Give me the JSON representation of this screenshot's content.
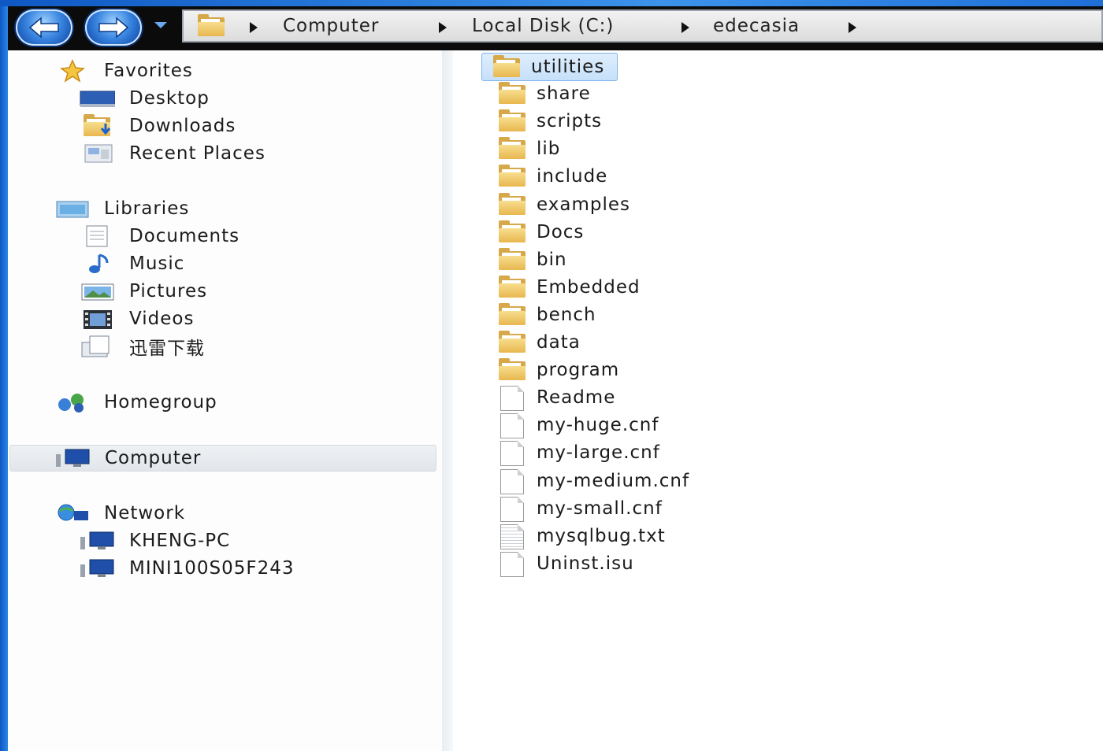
{
  "address_bar": {
    "crumbs": [
      "Computer",
      "Local Disk (C:)",
      "edecasia"
    ]
  },
  "nav_pane": {
    "favorites": {
      "label": "Favorites",
      "items": [
        "Desktop",
        "Downloads",
        "Recent Places"
      ]
    },
    "libraries": {
      "label": "Libraries",
      "items": [
        "Documents",
        "Music",
        "Pictures",
        "Videos",
        "迅雷下载"
      ]
    },
    "homegroup": {
      "label": "Homegroup"
    },
    "computer": {
      "label": "Computer"
    },
    "network": {
      "label": "Network",
      "items": [
        "KHENG-PC",
        "MINI100S05F243"
      ]
    }
  },
  "content": {
    "items": [
      {
        "name": "utilities",
        "type": "folder",
        "selected": true
      },
      {
        "name": "share",
        "type": "folder"
      },
      {
        "name": "scripts",
        "type": "folder"
      },
      {
        "name": "lib",
        "type": "folder"
      },
      {
        "name": "include",
        "type": "folder"
      },
      {
        "name": "examples",
        "type": "folder"
      },
      {
        "name": "Docs",
        "type": "folder"
      },
      {
        "name": "bin",
        "type": "folder"
      },
      {
        "name": "Embedded",
        "type": "folder"
      },
      {
        "name": "bench",
        "type": "folder"
      },
      {
        "name": "data",
        "type": "folder"
      },
      {
        "name": "program",
        "type": "folder"
      },
      {
        "name": "Readme",
        "type": "file"
      },
      {
        "name": "my-huge.cnf",
        "type": "file"
      },
      {
        "name": "my-large.cnf",
        "type": "file"
      },
      {
        "name": "my-medium.cnf",
        "type": "file"
      },
      {
        "name": "my-small.cnf",
        "type": "file"
      },
      {
        "name": "mysqlbug.txt",
        "type": "text-file"
      },
      {
        "name": "Uninst.isu",
        "type": "file"
      }
    ]
  },
  "icons": {
    "back": "back-arrow-icon",
    "forward": "forward-arrow-icon",
    "folder": "folder-icon",
    "file": "file-icon"
  },
  "colors": {
    "frame_blue": "#1a6fd0",
    "selection": "#c6e0fa",
    "folder_yellow": "#e8b74f"
  }
}
